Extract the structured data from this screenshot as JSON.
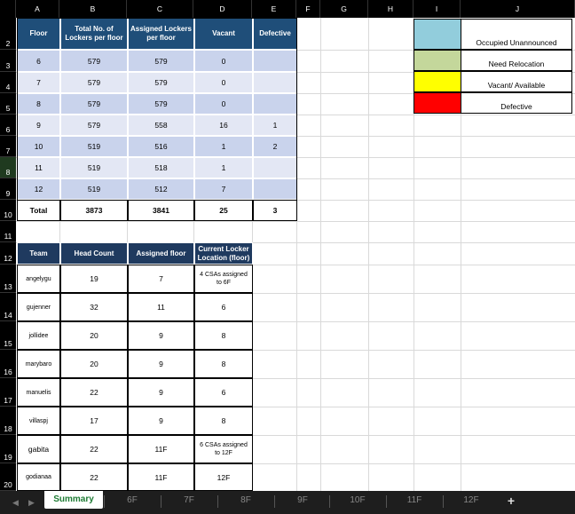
{
  "column_headers": [
    "A",
    "B",
    "C",
    "D",
    "E",
    "F",
    "G",
    "H",
    "I",
    "J"
  ],
  "row_headers": [
    "2",
    "3",
    "4",
    "5",
    "6",
    "7",
    "8",
    "9",
    "10",
    "11",
    "12",
    "13",
    "14",
    "15",
    "16",
    "17",
    "18",
    "19",
    "20"
  ],
  "table1": {
    "headers": [
      "Floor",
      "Total No. of Lockers per floor",
      "Assigned Lockers per floor",
      "Vacant",
      "Defective"
    ],
    "rows": [
      [
        "6",
        "579",
        "579",
        "0",
        ""
      ],
      [
        "7",
        "579",
        "579",
        "0",
        ""
      ],
      [
        "8",
        "579",
        "579",
        "0",
        ""
      ],
      [
        "9",
        "579",
        "558",
        "16",
        "1"
      ],
      [
        "10",
        "519",
        "516",
        "1",
        "2"
      ],
      [
        "11",
        "519",
        "518",
        "1",
        ""
      ],
      [
        "12",
        "519",
        "512",
        "7",
        ""
      ]
    ],
    "total": [
      "Total",
      "3873",
      "3841",
      "25",
      "3"
    ]
  },
  "table2": {
    "headers": [
      "Team",
      "Head Count",
      "Assigned floor",
      "Current Locker Location (floor)"
    ],
    "rows": [
      [
        "angelygu",
        "19",
        "7",
        "4 CSAs assigned to 6F"
      ],
      [
        "gujenner",
        "32",
        "11",
        "6"
      ],
      [
        "jollidee",
        "20",
        "9",
        "8"
      ],
      [
        "marybaro",
        "20",
        "9",
        "8"
      ],
      [
        "manuelis",
        "22",
        "9",
        "6"
      ],
      [
        "villaspj",
        "17",
        "9",
        "8"
      ],
      [
        "gabita",
        "22",
        "11F",
        "6 CSAs assigned to 12F"
      ],
      [
        "godianaa",
        "22",
        "11F",
        "12F"
      ]
    ]
  },
  "legend": [
    {
      "color": "#92cddc",
      "label": "Occupied Unannounced"
    },
    {
      "color": "#c4d79b",
      "label": "Need Relocation"
    },
    {
      "color": "#ffff00",
      "label": "Vacant/ Available"
    },
    {
      "color": "#ff0000",
      "label": "Defective"
    }
  ],
  "tabs": {
    "items": [
      "Summary",
      "6F",
      "7F",
      "8F",
      "9F",
      "10F",
      "11F",
      "12F"
    ],
    "active": "Summary",
    "add_label": "+",
    "nav_prev": "◀",
    "nav_next": "▶"
  }
}
